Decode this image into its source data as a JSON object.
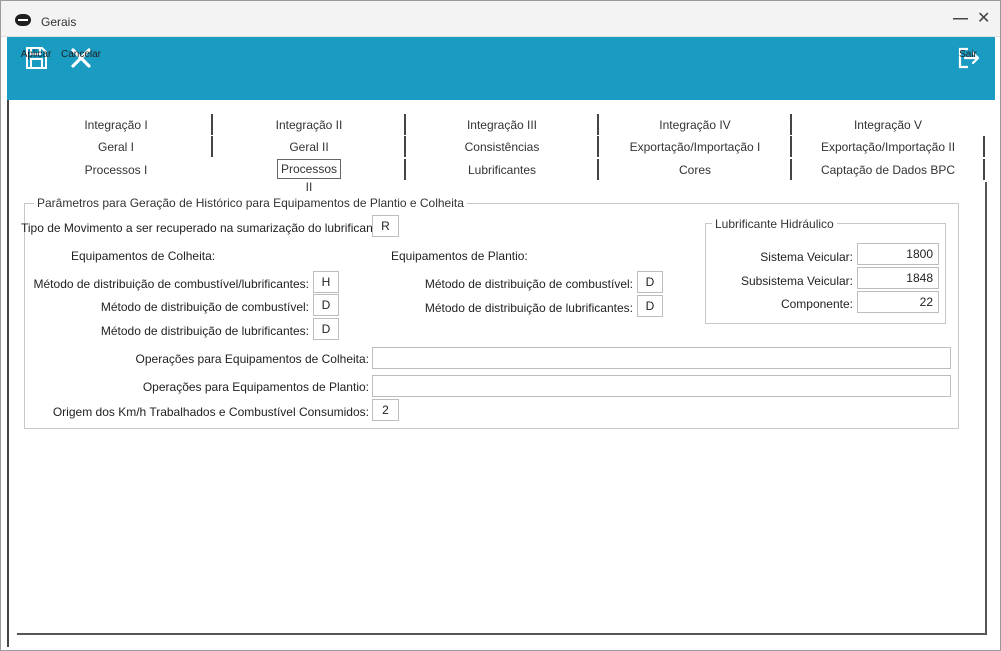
{
  "window": {
    "title": "Gerais"
  },
  "toolbar": {
    "apply_label": "Aplicar",
    "cancel_label": "Cancelar",
    "exit_label": "Sair",
    "color": "#1a9bc2"
  },
  "tabs": {
    "row1": [
      "Integração I",
      "Integração II",
      "Integração III",
      "Integração IV",
      "Integração V"
    ],
    "row2": [
      "Geral I",
      "Geral II",
      "Consistências",
      "Exportação/Importação I",
      "Exportação/Importação II"
    ],
    "row3": [
      "Processos I",
      "Processos II",
      "Lubrificantes",
      "Cores",
      "Captação de Dados BPC"
    ],
    "active": "Processos II"
  },
  "main_group": {
    "title": "Parâmetros para Geração de Histórico para Equipamentos de Plantio e Colheita",
    "tipo_movimento_label": "Tipo de Movimento a ser recuperado na sumarização do lubrificante:",
    "tipo_movimento_value": "R",
    "colheita": {
      "title": "Equipamentos de Colheita:",
      "comb_lub_label": "Método de distribuição de combustível/lubrificantes:",
      "comb_lub_value": "H",
      "comb_label": "Método de distribuição de combustível:",
      "comb_value": "D",
      "lub_label": "Método de distribuição de lubrificantes:",
      "lub_value": "D"
    },
    "plantio": {
      "title": "Equipamentos de Plantio:",
      "comb_label": "Método de distribuição de combustível:",
      "comb_value": "D",
      "lub_label": "Método de distribuição de lubrificantes:",
      "lub_value": "D"
    },
    "ops_colheita_label": "Operações para Equipamentos de Colheita:",
    "ops_colheita_value": "",
    "ops_plantio_label": "Operações para Equipamentos de Plantio:",
    "ops_plantio_value": "",
    "origem_label": "Origem dos Km/h Trabalhados e Combustível Consumidos:",
    "origem_value": "2"
  },
  "hydraulic_group": {
    "title": "Lubrificante Hidráulico",
    "sistema_label": "Sistema Veicular:",
    "sistema_value": "1800",
    "subsistema_label": "Subsistema Veicular:",
    "subsistema_value": "1848",
    "componente_label": "Componente:",
    "componente_value": "22"
  }
}
